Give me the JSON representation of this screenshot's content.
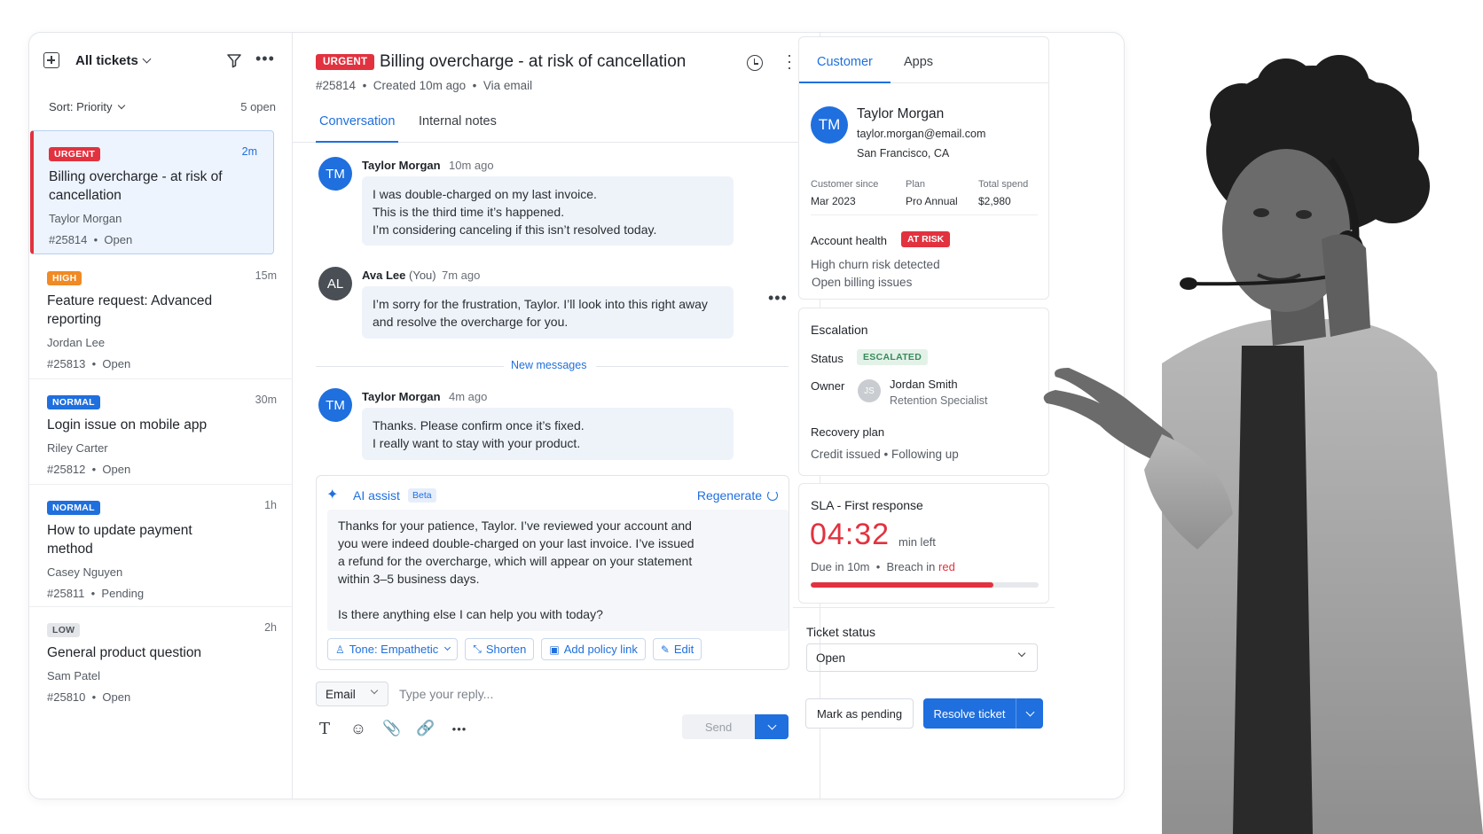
{
  "list": {
    "title": "All tickets",
    "sort_label": "Sort: Priority",
    "open_count": "5 open",
    "tickets": [
      {
        "priority": "URGENT",
        "age": "2m",
        "title": "Billing overcharge - at risk of cancellation",
        "customer": "Taylor Morgan",
        "id": "#25814",
        "status": "Open"
      },
      {
        "priority": "HIGH",
        "age": "15m",
        "title": "Feature request: Advanced reporting",
        "customer": "Jordan Lee",
        "id": "#25813",
        "status": "Open"
      },
      {
        "priority": "NORMAL",
        "age": "30m",
        "title": "Login issue on mobile app",
        "customer": "Riley Carter",
        "id": "#25812",
        "status": "Open"
      },
      {
        "priority": "NORMAL",
        "age": "1h",
        "title": "How to update payment method",
        "customer": "Casey Nguyen",
        "id": "#25811",
        "status": "Pending"
      },
      {
        "priority": "LOW",
        "age": "2h",
        "title": "General product question",
        "customer": "Sam Patel",
        "id": "#25810",
        "status": "Open"
      }
    ]
  },
  "ticket": {
    "priority": "URGENT",
    "title": "Billing overcharge - at risk of cancellation",
    "id": "#25814",
    "created": "Created 10m ago",
    "via": "Via email",
    "tabs": [
      "Conversation",
      "Internal notes"
    ]
  },
  "messages": [
    {
      "initials": "TM",
      "author": "Taylor Morgan",
      "author_note": "",
      "time": "10m ago",
      "lines": [
        "I was double-charged on my last invoice.",
        "This is the third time it’s happened.",
        "I’m considering canceling if this isn’t resolved today."
      ]
    },
    {
      "initials": "AL",
      "author": "Ava Lee",
      "author_note": "(You)",
      "time": "7m ago",
      "lines": [
        "I’m sorry for the frustration, Taylor. I’ll look into this right away",
        "and resolve the overcharge for you."
      ]
    },
    {
      "initials": "TM",
      "author": "Taylor Morgan",
      "author_note": "",
      "time": "4m ago",
      "lines": [
        "Thanks. Please confirm once it’s fixed.",
        "I really want to stay with your product."
      ]
    }
  ],
  "new_messages_label": "New messages",
  "ai_assist": {
    "label": "AI assist",
    "beta": "Beta",
    "regenerate": "Regenerate",
    "draft_p1": [
      "Thanks for your patience, Taylor. I’ve reviewed your account and",
      "you were indeed double-charged on your last invoice. I’ve issued",
      "a refund for the overcharge, which will appear on your statement",
      "within 3–5 business days."
    ],
    "draft_p2": "Is there anything else I can help you with today?",
    "chips": {
      "tone": "Tone: Empathetic",
      "shorten": "Shorten",
      "policy": "Add policy link",
      "edit": "Edit"
    }
  },
  "composer": {
    "channel": "Email",
    "placeholder": "Type your reply...",
    "send": "Send"
  },
  "customer_panel": {
    "tabs": [
      "Customer",
      "Apps"
    ],
    "initials": "TM",
    "name": "Taylor Morgan",
    "email": "taylor.morgan@email.com",
    "location": "San Francisco, CA",
    "stats": [
      {
        "label": "Customer since",
        "value": "Mar 2023"
      },
      {
        "label": "Plan",
        "value": "Pro Annual"
      },
      {
        "label": "Total spend",
        "value": "$2,980"
      }
    ],
    "health_label": "Account health",
    "health_badge": "AT RISK",
    "health_notes": [
      "High churn risk detected",
      "Open billing issues"
    ]
  },
  "escalation": {
    "title": "Escalation",
    "status_label": "Status",
    "status_badge": "ESCALATED",
    "owner_label": "Owner",
    "owner_initials": "JS",
    "owner_name": "Jordan Smith",
    "owner_role": "Retention Specialist",
    "plan_label": "Recovery plan",
    "plan_value": "Credit issued • Following up"
  },
  "sla": {
    "title": "SLA - First response",
    "time": "04:32",
    "time_suffix": "min left",
    "due": "Due in 10m",
    "breach_prefix": "Breach in",
    "breach_color": "red",
    "progress": 0.8
  },
  "ticket_status": {
    "title": "Ticket status",
    "value": "Open",
    "pending_button": "Mark as pending",
    "resolve_button": "Resolve ticket"
  },
  "colors": {
    "accent": "#1f6fde",
    "urgent": "#e2323f",
    "high": "#f08a24",
    "escalated_bg": "#e3f2e8"
  }
}
